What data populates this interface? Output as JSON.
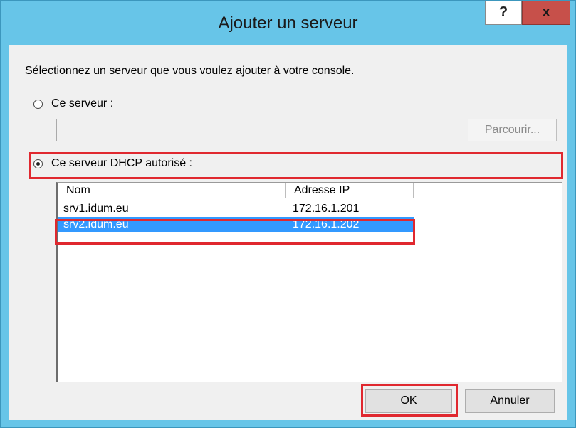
{
  "dialog": {
    "title": "Ajouter un serveur",
    "help_label": "?",
    "close_label": "x"
  },
  "instruction": "Sélectionnez un serveur que vous voulez ajouter à votre console.",
  "option_this_server": {
    "label": "Ce serveur :",
    "selected": false,
    "input_value": "",
    "browse_label": "Parcourir...",
    "browse_enabled": false
  },
  "option_authorized": {
    "label": "Ce serveur DHCP autorisé :",
    "selected": true
  },
  "list": {
    "columns": [
      "Nom",
      "Adresse IP"
    ],
    "rows": [
      {
        "name": "srv1.idum.eu",
        "ip": "172.16.1.201",
        "selected": false
      },
      {
        "name": "srv2.idum.eu",
        "ip": "172.16.1.202",
        "selected": true
      }
    ]
  },
  "buttons": {
    "ok": "OK",
    "cancel": "Annuler"
  },
  "colors": {
    "titlebar": "#67c5e8",
    "close_button": "#c7504a",
    "selection": "#3399ff",
    "annotation": "#e0282f"
  }
}
